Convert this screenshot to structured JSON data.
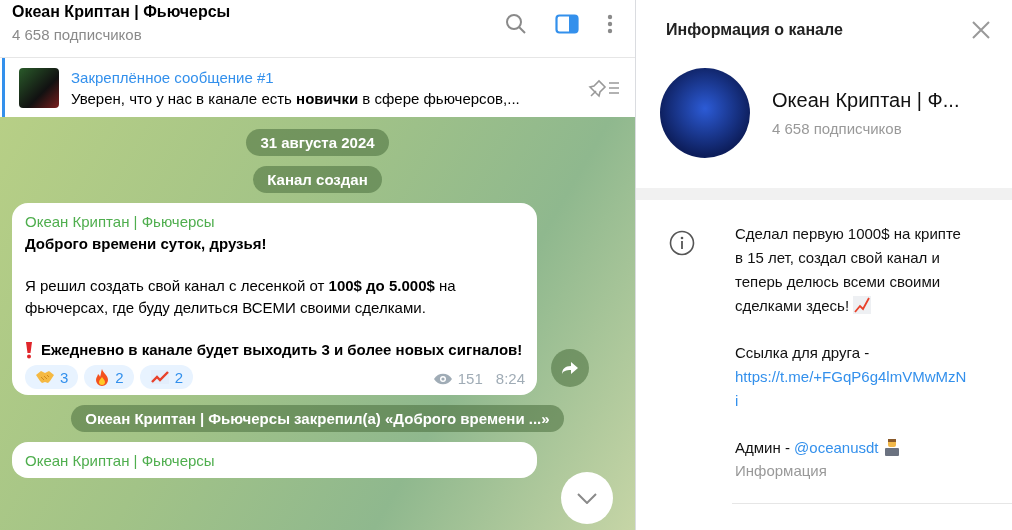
{
  "chat_header": {
    "title": "Океан Криптан | Фьючерсы",
    "subtitle": "4 658 подписчиков"
  },
  "pinned": {
    "title": "Закреплённое сообщение #1",
    "text": "Уверен, что у нас в канале есть **новички** в сфере фьючерсов,..."
  },
  "messages": [
    {
      "kind": "service",
      "text": "31 августа 2024"
    },
    {
      "kind": "service",
      "text": "Канал создан"
    },
    {
      "kind": "post",
      "author": "Океан Криптан | Фьючерсы",
      "paragraphs": [
        {
          "kind": "heading",
          "text": "Доброго времени суток, друзья!"
        },
        {
          "kind": "text",
          "text": "Я решил создать свой канал с лесенкой от **100$ до 5.000$** на фьючерсах, где буду делиться ВСЕМИ своими сделками."
        },
        {
          "kind": "alert",
          "text": "Ежедневно в канале будет  выходить 3 и более новых сигналов!"
        }
      ],
      "reactions": [
        {
          "kind": "handshake",
          "count": "3"
        },
        {
          "kind": "fire",
          "count": "2"
        },
        {
          "kind": "chart",
          "count": "2"
        }
      ],
      "views": "151",
      "time": "8:24"
    },
    {
      "kind": "service",
      "text": "Океан Криптан | Фьючерсы закрепил(а) «Доброго времени ...»"
    },
    {
      "kind": "post",
      "author": "Океан Криптан | Фьючерсы"
    }
  ],
  "info_panel": {
    "title": "Информация о канале",
    "name": "Океан Криптан | Ф...",
    "subtitle": "4 658 подписчиков",
    "about": [
      {
        "kind": "text",
        "text": "Сделал первую 1000$ на крипте в 15 лет, создал свой канал и теперь делюсь всеми своими сделками здесь!"
      },
      {
        "kind": "link",
        "label": "Ссылка для друга -",
        "url": "https://t.me/+FGqP6g4lmVMwMzNi"
      },
      {
        "kind": "mention",
        "label": "Админ -",
        "handle": "@oceanusdt"
      }
    ],
    "caption": "Информация"
  }
}
